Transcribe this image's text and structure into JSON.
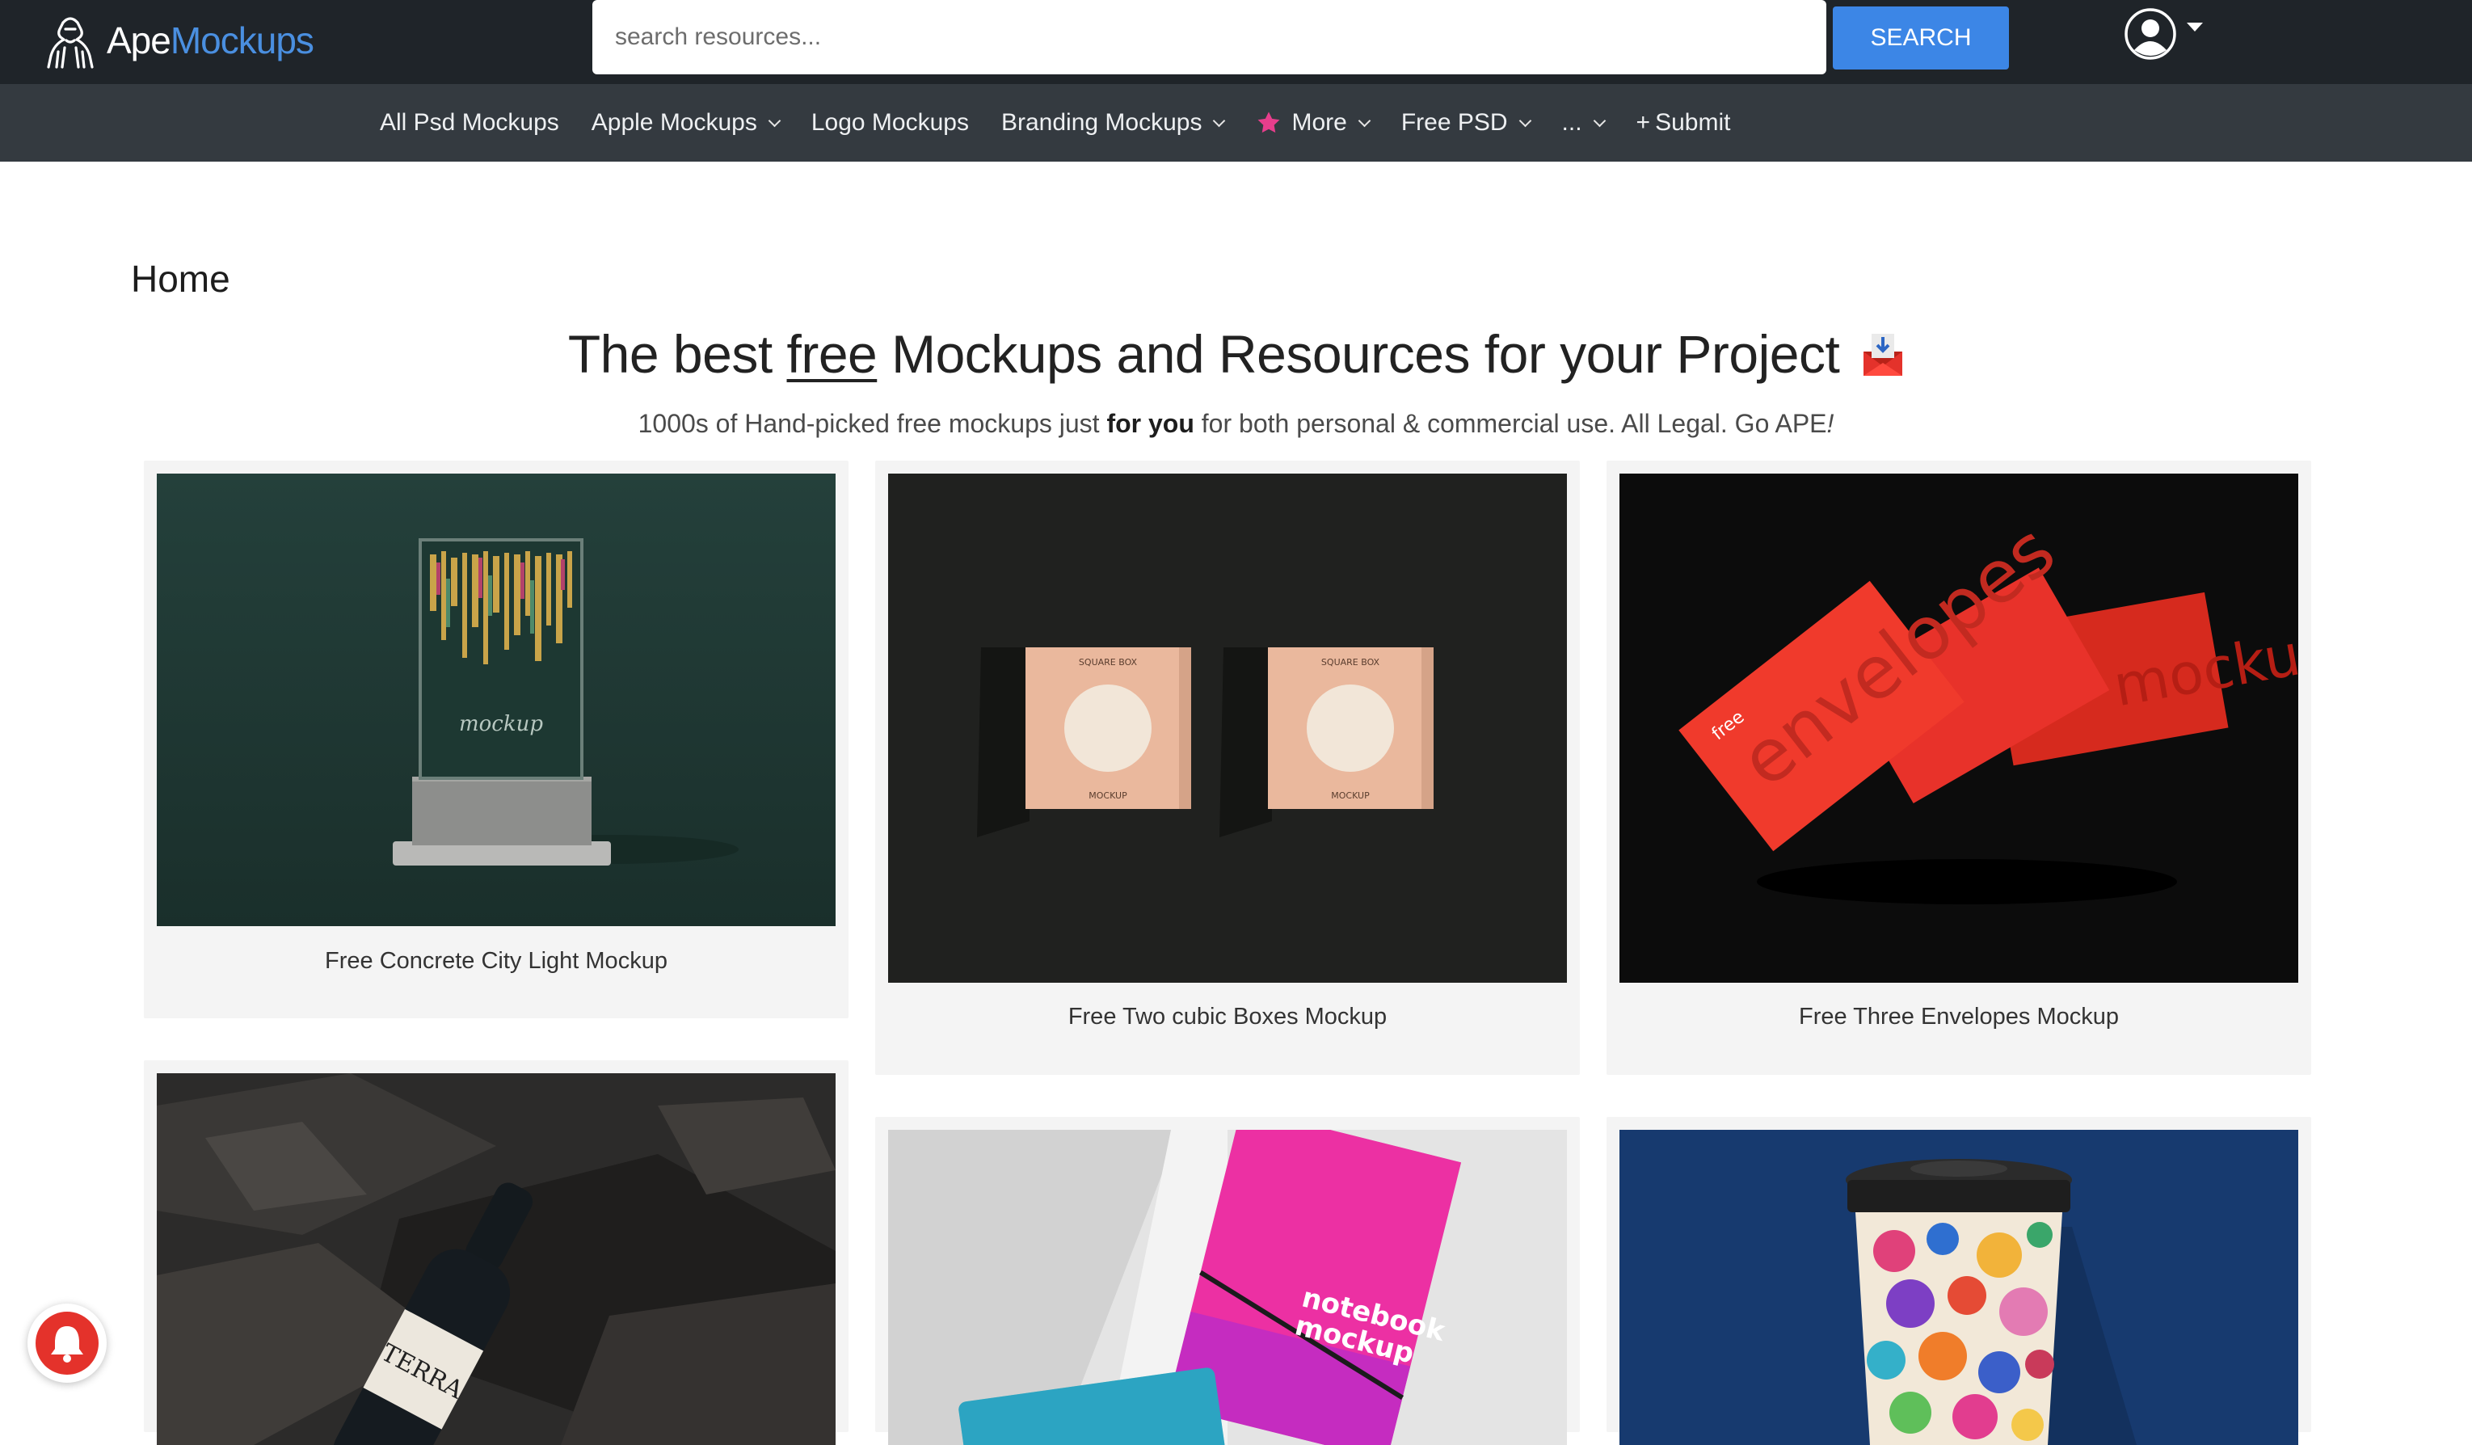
{
  "header": {
    "logo_part1": "Ape",
    "logo_part2": "Mockups",
    "search_placeholder": "search resources...",
    "search_label": "SEARCH"
  },
  "nav": {
    "items": [
      {
        "label": "All Psd Mockups",
        "dropdown": false
      },
      {
        "label": "Apple Mockups",
        "dropdown": true
      },
      {
        "label": "Logo Mockups",
        "dropdown": false
      },
      {
        "label": "Branding Mockups",
        "dropdown": true
      },
      {
        "label": "More",
        "dropdown": true,
        "icon": "star-icon"
      },
      {
        "label": "Free PSD",
        "dropdown": true
      },
      {
        "label": "...",
        "dropdown": true
      },
      {
        "label": "Submit",
        "dropdown": false,
        "icon": "plus-icon"
      }
    ]
  },
  "breadcrumb": "Home",
  "hero": {
    "title_before": "The best ",
    "title_emph": "free",
    "title_after": " Mockups and Resources for your Project",
    "sub_before": "1000s of Hand-picked free mockups just ",
    "sub_bold": "for you",
    "sub_after": " for both personal & commercial use. All Legal. Go APE",
    "sub_end": "!"
  },
  "cards": [
    {
      "title": "Free Concrete City Light Mockup",
      "thumb_label": "mockup"
    },
    {
      "title": "Free Two cubic Boxes Mockup",
      "box_top": "SQUARE BOX",
      "box_bottom": "MOCKUP"
    },
    {
      "title": "Free Three Envelopes Mockup",
      "env_text_1": "free",
      "env_text_2": "envelopes",
      "env_text_3": "mockup"
    },
    {
      "title": "",
      "bottle_label": "TERRA"
    },
    {
      "title": "",
      "notebook_text_1": "notebook",
      "notebook_text_2": "mockup"
    },
    {
      "title": ""
    }
  ],
  "colors": {
    "topbar": "#1f2429",
    "navbar": "#343a40",
    "accent": "#3c86e6",
    "star": "#e83e8c",
    "bell": "#e4322b"
  }
}
